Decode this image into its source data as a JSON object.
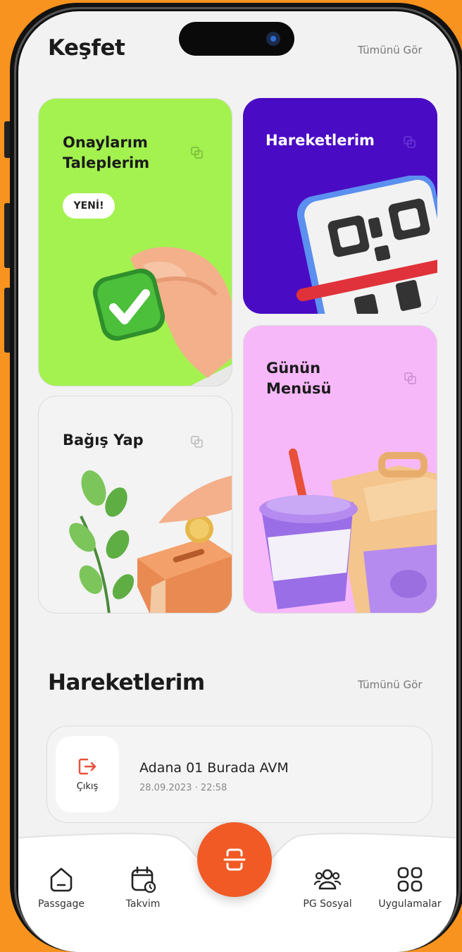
{
  "discover": {
    "title": "Keşfet",
    "see_all": "Tümünü Gör"
  },
  "cards": {
    "approvals": {
      "title": "Onaylarım\nTaleplerim",
      "badge": "YENİ!",
      "color": "#A3F24F"
    },
    "movements": {
      "title": "Hareketlerim",
      "color": "#4A0BC4"
    },
    "donate": {
      "title": "Bağış Yap",
      "color": "#F3F3F3"
    },
    "menu": {
      "title": "Günün\nMenüsü",
      "color": "#F7B8FA"
    }
  },
  "movements_section": {
    "title": "Hareketlerim",
    "see_all": "Tümünü Gör",
    "items": [
      {
        "type_label": "Çıkış",
        "place": "Adana 01 Burada AVM",
        "time": "28.09.2023 · 22:58",
        "icon": "exit-door-icon"
      }
    ]
  },
  "tabbar": {
    "items": [
      {
        "label": "Passgage",
        "icon": "home-icon"
      },
      {
        "label": "Takvim",
        "icon": "calendar-icon"
      },
      {
        "label": "PG Sosyal",
        "icon": "people-icon"
      },
      {
        "label": "Uygulamalar",
        "icon": "apps-grid-icon"
      }
    ],
    "center_icon": "scan-icon"
  },
  "colors": {
    "accent": "#F15A24",
    "frame_background": "#F7931E"
  }
}
